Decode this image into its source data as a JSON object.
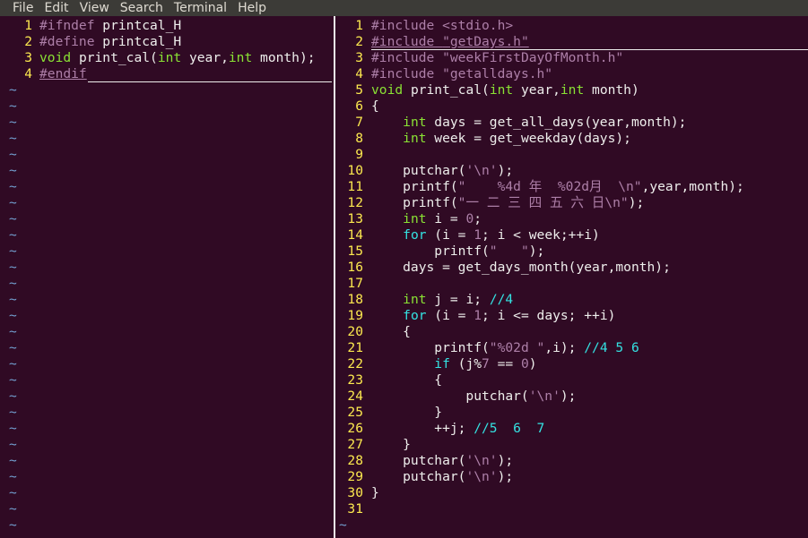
{
  "menu": [
    "File",
    "Edit",
    "View",
    "Search",
    "Terminal",
    "Help"
  ],
  "left_pane": {
    "lines": [
      {
        "n": "1",
        "parts": [
          [
            "pp",
            "#ifndef "
          ],
          [
            "id",
            "printcal_H"
          ]
        ]
      },
      {
        "n": "2",
        "parts": [
          [
            "pp",
            "#define "
          ],
          [
            "id",
            "printcal_H"
          ]
        ]
      },
      {
        "n": "3",
        "parts": [
          [
            "ty",
            "void"
          ],
          [
            "id",
            " print_cal("
          ],
          [
            "ty",
            "int"
          ],
          [
            "id",
            " year,"
          ],
          [
            "ty",
            "int"
          ],
          [
            "id",
            " month);"
          ]
        ]
      },
      {
        "n": "4",
        "parts": [
          [
            "pp",
            "#endif"
          ]
        ]
      }
    ],
    "tilde_count": 28
  },
  "right_pane": {
    "lines": [
      {
        "n": "1",
        "parts": [
          [
            "pp",
            "#include "
          ],
          [
            "str",
            "<stdio.h>"
          ]
        ]
      },
      {
        "n": "2",
        "parts": [
          [
            "pp",
            "#include "
          ],
          [
            "str",
            "\"getDays.h\""
          ]
        ]
      },
      {
        "n": "3",
        "parts": [
          [
            "pp",
            "#include "
          ],
          [
            "str",
            "\"weekFirstDayOfMonth.h\""
          ]
        ]
      },
      {
        "n": "4",
        "parts": [
          [
            "pp",
            "#include "
          ],
          [
            "str",
            "\"getalldays.h\""
          ]
        ]
      },
      {
        "n": "5",
        "parts": [
          [
            "ty",
            "void"
          ],
          [
            "id",
            " print_cal("
          ],
          [
            "ty",
            "int"
          ],
          [
            "id",
            " year,"
          ],
          [
            "ty",
            "int"
          ],
          [
            "id",
            " month)"
          ]
        ]
      },
      {
        "n": "6",
        "parts": [
          [
            "id",
            "{"
          ]
        ]
      },
      {
        "n": "7",
        "parts": [
          [
            "id",
            "    "
          ],
          [
            "ty",
            "int"
          ],
          [
            "id",
            " days = get_all_days(year,month);"
          ]
        ]
      },
      {
        "n": "8",
        "parts": [
          [
            "id",
            "    "
          ],
          [
            "ty",
            "int"
          ],
          [
            "id",
            " week = get_weekday(days);"
          ]
        ]
      },
      {
        "n": "9",
        "parts": []
      },
      {
        "n": "10",
        "parts": [
          [
            "id",
            "    putchar("
          ],
          [
            "str",
            "'\\n'"
          ],
          [
            "id",
            ");"
          ]
        ]
      },
      {
        "n": "11",
        "parts": [
          [
            "id",
            "    printf("
          ],
          [
            "str",
            "\"    %4d 年  %02d月  \\n\""
          ],
          [
            "id",
            ",year,month);"
          ]
        ]
      },
      {
        "n": "12",
        "parts": [
          [
            "id",
            "    printf("
          ],
          [
            "str",
            "\"一 二 三 四 五 六 日\\n\""
          ],
          [
            "id",
            ");"
          ]
        ]
      },
      {
        "n": "13",
        "parts": [
          [
            "id",
            "    "
          ],
          [
            "ty",
            "int"
          ],
          [
            "id",
            " i = "
          ],
          [
            "num",
            "0"
          ],
          [
            "id",
            ";"
          ]
        ]
      },
      {
        "n": "14",
        "parts": [
          [
            "id",
            "    "
          ],
          [
            "kw",
            "for"
          ],
          [
            "id",
            " (i = "
          ],
          [
            "num",
            "1"
          ],
          [
            "id",
            "; i < week;++i)"
          ]
        ]
      },
      {
        "n": "15",
        "parts": [
          [
            "id",
            "        printf("
          ],
          [
            "str",
            "\"   \""
          ],
          [
            "id",
            ");"
          ]
        ]
      },
      {
        "n": "16",
        "parts": [
          [
            "id",
            "    days = get_days_month(year,month);"
          ]
        ]
      },
      {
        "n": "17",
        "parts": []
      },
      {
        "n": "18",
        "parts": [
          [
            "id",
            "    "
          ],
          [
            "ty",
            "int"
          ],
          [
            "id",
            " j = i; "
          ],
          [
            "cm",
            "//4"
          ]
        ]
      },
      {
        "n": "19",
        "parts": [
          [
            "id",
            "    "
          ],
          [
            "kw",
            "for"
          ],
          [
            "id",
            " (i = "
          ],
          [
            "num",
            "1"
          ],
          [
            "id",
            "; i <= days; ++i)"
          ]
        ]
      },
      {
        "n": "20",
        "parts": [
          [
            "id",
            "    {"
          ]
        ]
      },
      {
        "n": "21",
        "parts": [
          [
            "id",
            "        printf("
          ],
          [
            "str",
            "\"%02d \""
          ],
          [
            "id",
            ",i); "
          ],
          [
            "cm",
            "//4 5 6"
          ]
        ]
      },
      {
        "n": "22",
        "parts": [
          [
            "id",
            "        "
          ],
          [
            "kw",
            "if"
          ],
          [
            "id",
            " (j%"
          ],
          [
            "num",
            "7"
          ],
          [
            "id",
            " == "
          ],
          [
            "num",
            "0"
          ],
          [
            "id",
            ")"
          ]
        ]
      },
      {
        "n": "23",
        "parts": [
          [
            "id",
            "        {"
          ]
        ]
      },
      {
        "n": "24",
        "parts": [
          [
            "id",
            "            putchar("
          ],
          [
            "str",
            "'\\n'"
          ],
          [
            "id",
            ");"
          ]
        ]
      },
      {
        "n": "25",
        "parts": [
          [
            "id",
            "        }"
          ]
        ]
      },
      {
        "n": "26",
        "parts": [
          [
            "id",
            "        ++j; "
          ],
          [
            "cm",
            "//5  6  7"
          ]
        ]
      },
      {
        "n": "27",
        "parts": [
          [
            "id",
            "    }"
          ]
        ]
      },
      {
        "n": "28",
        "parts": [
          [
            "id",
            "    putchar("
          ],
          [
            "str",
            "'\\n'"
          ],
          [
            "id",
            ");"
          ]
        ]
      },
      {
        "n": "29",
        "parts": [
          [
            "id",
            "    putchar("
          ],
          [
            "str",
            "'\\n'"
          ],
          [
            "id",
            ");"
          ]
        ]
      },
      {
        "n": "30",
        "parts": [
          [
            "id",
            "}"
          ]
        ]
      },
      {
        "n": "31",
        "parts": []
      }
    ],
    "tilde_count": 1
  },
  "colors": {
    "background": "#300a24",
    "line_number": "#fce94f",
    "keyword": "#34e2e2",
    "type": "#8ae234",
    "preprocessor": "#ad7fa8",
    "tilde": "#729fcf"
  }
}
